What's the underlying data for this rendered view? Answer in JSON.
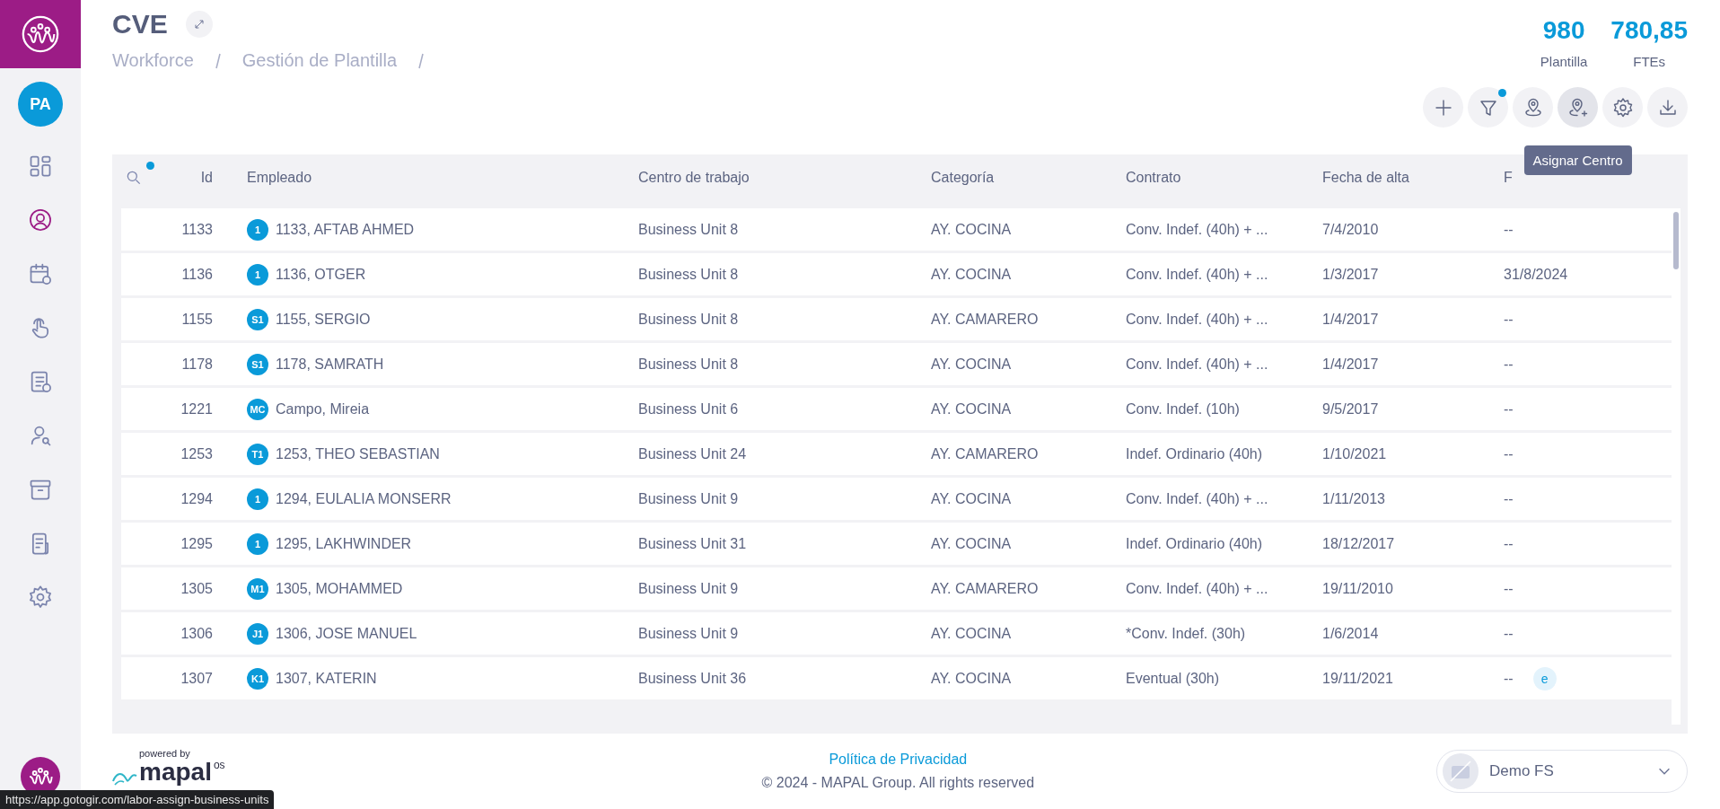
{
  "sidebar": {
    "avatar": "PA",
    "items": [
      {
        "kind": "dashboard",
        "selected": false
      },
      {
        "kind": "user",
        "selected": true
      },
      {
        "kind": "calendar",
        "selected": false
      },
      {
        "kind": "hand",
        "selected": false
      },
      {
        "kind": "document-clock",
        "selected": false
      },
      {
        "kind": "user-search",
        "selected": false
      },
      {
        "kind": "archive",
        "selected": false
      },
      {
        "kind": "document",
        "selected": false
      },
      {
        "kind": "settings",
        "selected": false
      }
    ]
  },
  "header": {
    "title": "CVE",
    "breadcrumb": [
      "Workforce",
      "Gestión de Plantilla"
    ],
    "stats": [
      {
        "value": "980",
        "label": "Plantilla"
      },
      {
        "value": "780,85",
        "label": "FTEs"
      }
    ]
  },
  "toolbar": [
    {
      "kind": "add",
      "dot": false,
      "hovered": false
    },
    {
      "kind": "filter",
      "dot": true,
      "hovered": false
    },
    {
      "kind": "location",
      "dot": false,
      "hovered": false
    },
    {
      "kind": "location-add",
      "dot": false,
      "hovered": true,
      "tooltip": "Asignar Centro"
    },
    {
      "kind": "settings",
      "dot": false,
      "hovered": false
    },
    {
      "kind": "download",
      "dot": false,
      "hovered": false
    }
  ],
  "table": {
    "search_dot": true,
    "columns": [
      "Id",
      "Empleado",
      "Centro de trabajo",
      "Categoría",
      "Contrato",
      "Fecha de alta",
      "F"
    ],
    "rows": [
      {
        "id": "1133",
        "initials": "1",
        "name": "1133, AFTAB AHMED",
        "centro": "Business Unit 8",
        "categoria": "AY. COCINA",
        "contrato": "Conv. Indef. (40h) + ...",
        "alta": "7/4/2010",
        "column_7": "--"
      },
      {
        "id": "1136",
        "initials": "1",
        "name": "1136, OTGER",
        "centro": "Business Unit 8",
        "categoria": "AY. COCINA",
        "contrato": "Conv. Indef. (40h) + ...",
        "alta": "1/3/2017",
        "column_7": "31/8/2024"
      },
      {
        "id": "1155",
        "initials": "S1",
        "name": "1155, SERGIO",
        "centro": "Business Unit 8",
        "categoria": "AY. CAMARERO",
        "contrato": "Conv. Indef. (40h) + ...",
        "alta": "1/4/2017",
        "column_7": "--"
      },
      {
        "id": "1178",
        "initials": "S1",
        "name": "1178, SAMRATH",
        "centro": "Business Unit 8",
        "categoria": "AY. COCINA",
        "contrato": "Conv. Indef. (40h) + ...",
        "alta": "1/4/2017",
        "column_7": "--"
      },
      {
        "id": "1221",
        "initials": "MC",
        "name": "Campo, Mireia",
        "centro": "Business Unit 6",
        "categoria": "AY. COCINA",
        "contrato": "Conv. Indef. (10h)",
        "alta": "9/5/2017",
        "column_7": "--"
      },
      {
        "id": "1253",
        "initials": "T1",
        "name": "1253, THEO SEBASTIAN",
        "centro": "Business Unit 24",
        "categoria": "AY. CAMARERO",
        "contrato": "Indef. Ordinario (40h)",
        "alta": "1/10/2021",
        "column_7": "--"
      },
      {
        "id": "1294",
        "initials": "1",
        "name": "1294, EULALIA MONSERR",
        "centro": "Business Unit 9",
        "categoria": "AY. COCINA",
        "contrato": "Conv. Indef. (40h) + ...",
        "alta": "1/11/2013",
        "column_7": "--"
      },
      {
        "id": "1295",
        "initials": "1",
        "name": "1295, LAKHWINDER",
        "centro": "Business Unit 31",
        "categoria": "AY. COCINA",
        "contrato": "Indef. Ordinario (40h)",
        "alta": "18/12/2017",
        "column_7": "--"
      },
      {
        "id": "1305",
        "initials": "M1",
        "name": "1305, MOHAMMED",
        "centro": "Business Unit 9",
        "categoria": "AY. CAMARERO",
        "contrato": "Conv. Indef. (40h) + ...",
        "alta": "19/11/2010",
        "column_7": "--"
      },
      {
        "id": "1306",
        "initials": "J1",
        "name": "1306, JOSE MANUEL",
        "centro": "Business Unit 9",
        "categoria": "AY. COCINA",
        "contrato": "*Conv. Indef. (30h)",
        "alta": "1/6/2014",
        "column_7": "--"
      },
      {
        "id": "1307",
        "initials": "K1",
        "name": "1307, KATERIN",
        "centro": "Business Unit 36",
        "categoria": "AY. COCINA",
        "contrato": "Eventual (30h)",
        "alta": "19/11/2021",
        "column_7": "--",
        "tag": "e"
      }
    ]
  },
  "footer": {
    "powered_by": "powered by",
    "brand": "mapal",
    "brand_suffix": "os",
    "privacy_link": "Política de Privacidad",
    "copyright": "© 2024 - MAPAL Group. All rights reserved",
    "account": "Demo FS"
  },
  "status_url": "https://app.gotogir.com/labor-assign-business-units"
}
